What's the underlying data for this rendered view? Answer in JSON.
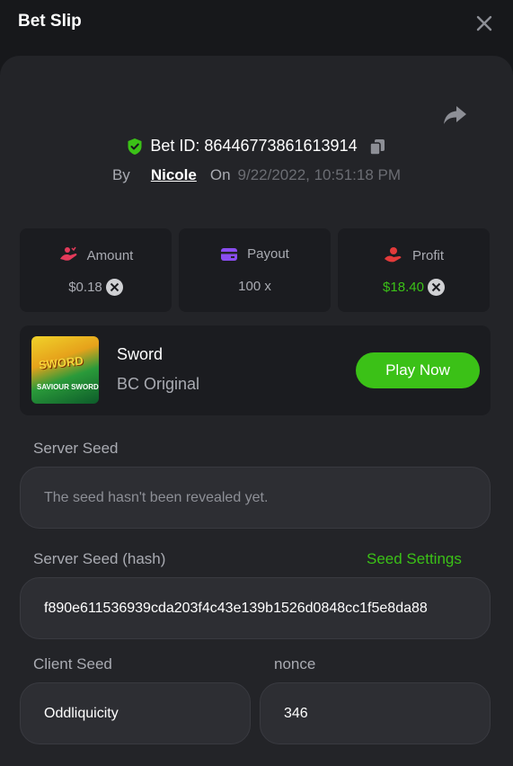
{
  "header": {
    "title": "Bet Slip"
  },
  "bet": {
    "id_label": "Bet ID: 86446773861613914",
    "by_label": "By",
    "user": "Nicole",
    "on_label": "On",
    "date": "9/22/2022, 10:51:18 PM"
  },
  "stats": {
    "amount": {
      "label": "Amount",
      "value": "$0.18"
    },
    "payout": {
      "label": "Payout",
      "value": "100 x"
    },
    "profit": {
      "label": "Profit",
      "value": "$18.40"
    }
  },
  "game": {
    "thumb_title": "SWORD",
    "thumb_sub": "SAVIOUR SWORD",
    "name": "Sword",
    "provider": "BC Original",
    "play_label": "Play Now"
  },
  "server_seed": {
    "label": "Server Seed",
    "value": "The seed hasn't been revealed yet."
  },
  "server_seed_hash": {
    "label": "Server Seed (hash)",
    "settings_label": "Seed Settings",
    "value": "f890e611536939cda203f4c43e139b1526d0848cc1f5e8da88"
  },
  "client_seed": {
    "label": "Client Seed",
    "value": "Oddliquicity"
  },
  "nonce": {
    "label": "nonce",
    "value": "346"
  },
  "colors": {
    "accent_green": "#3bc117",
    "amount_icon": "#e33a5a",
    "payout_icon": "#8a4df0",
    "profit_icon": "#e33a3a"
  }
}
